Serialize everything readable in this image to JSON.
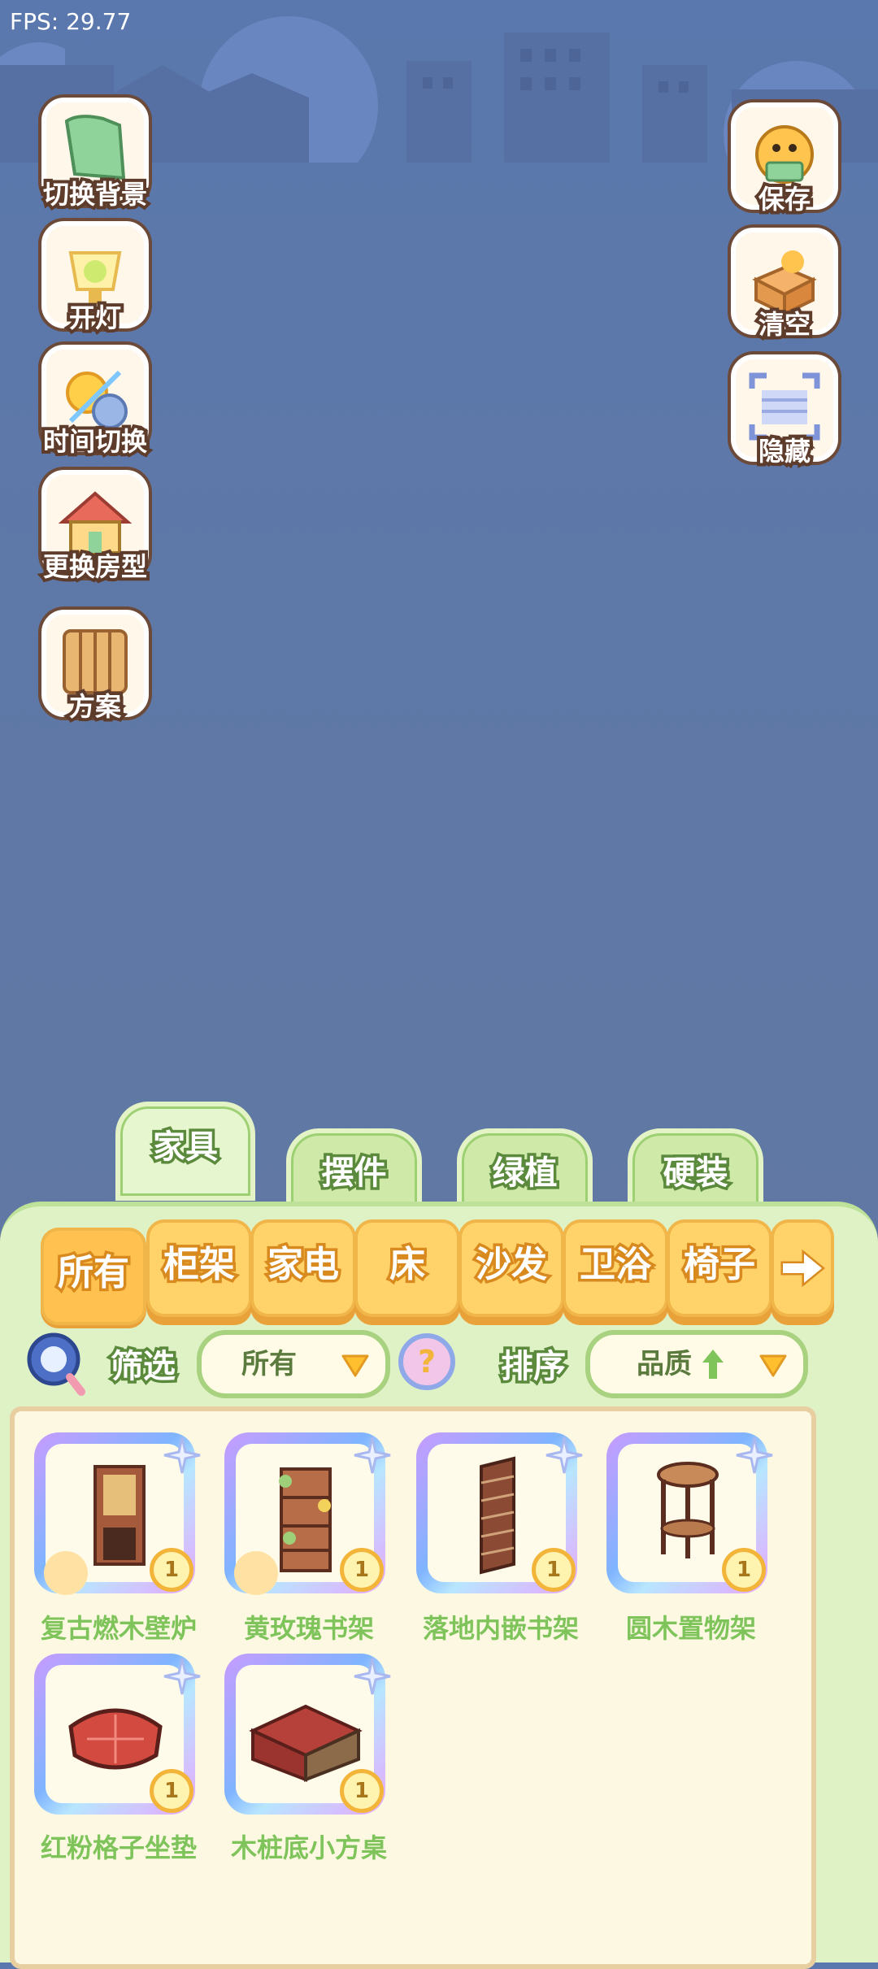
{
  "fps": "FPS: 29.77",
  "left_actions": [
    {
      "label": "切换背景",
      "icon": "roll-background-icon"
    },
    {
      "label": "开灯",
      "icon": "lamp-icon"
    },
    {
      "label": "时间切换",
      "icon": "sun-moon-icon"
    },
    {
      "label": "更换房型",
      "icon": "house-icon"
    },
    {
      "label": "方案",
      "icon": "blueprint-icon"
    }
  ],
  "right_actions": [
    {
      "label": "保存",
      "icon": "save-duck-icon"
    },
    {
      "label": "清空",
      "icon": "clear-box-icon"
    },
    {
      "label": "隐藏",
      "icon": "hide-icon"
    }
  ],
  "category_tabs": [
    "家具",
    "摆件",
    "绿植",
    "硬装"
  ],
  "sub_tabs": [
    "所有",
    "柜架",
    "家电",
    "床",
    "沙发",
    "卫浴",
    "椅子"
  ],
  "filter": {
    "label": "筛选",
    "value": "所有"
  },
  "sort": {
    "label": "排序",
    "value": "品质"
  },
  "items": [
    {
      "name": "复古燃木壁炉",
      "qty": "1",
      "lit": true
    },
    {
      "name": "黄玫瑰书架",
      "qty": "1",
      "lit": true
    },
    {
      "name": "落地内嵌书架",
      "qty": "1",
      "lit": false
    },
    {
      "name": "圆木置物架",
      "qty": "1",
      "lit": false
    },
    {
      "name": "红粉格子坐垫",
      "qty": "1",
      "lit": false
    },
    {
      "name": "木桩底小方桌",
      "qty": "1",
      "lit": false
    }
  ],
  "colors": {
    "accent_orange": "#ffc250",
    "green_text": "#7ec45b",
    "panel": "#dff2c6"
  }
}
